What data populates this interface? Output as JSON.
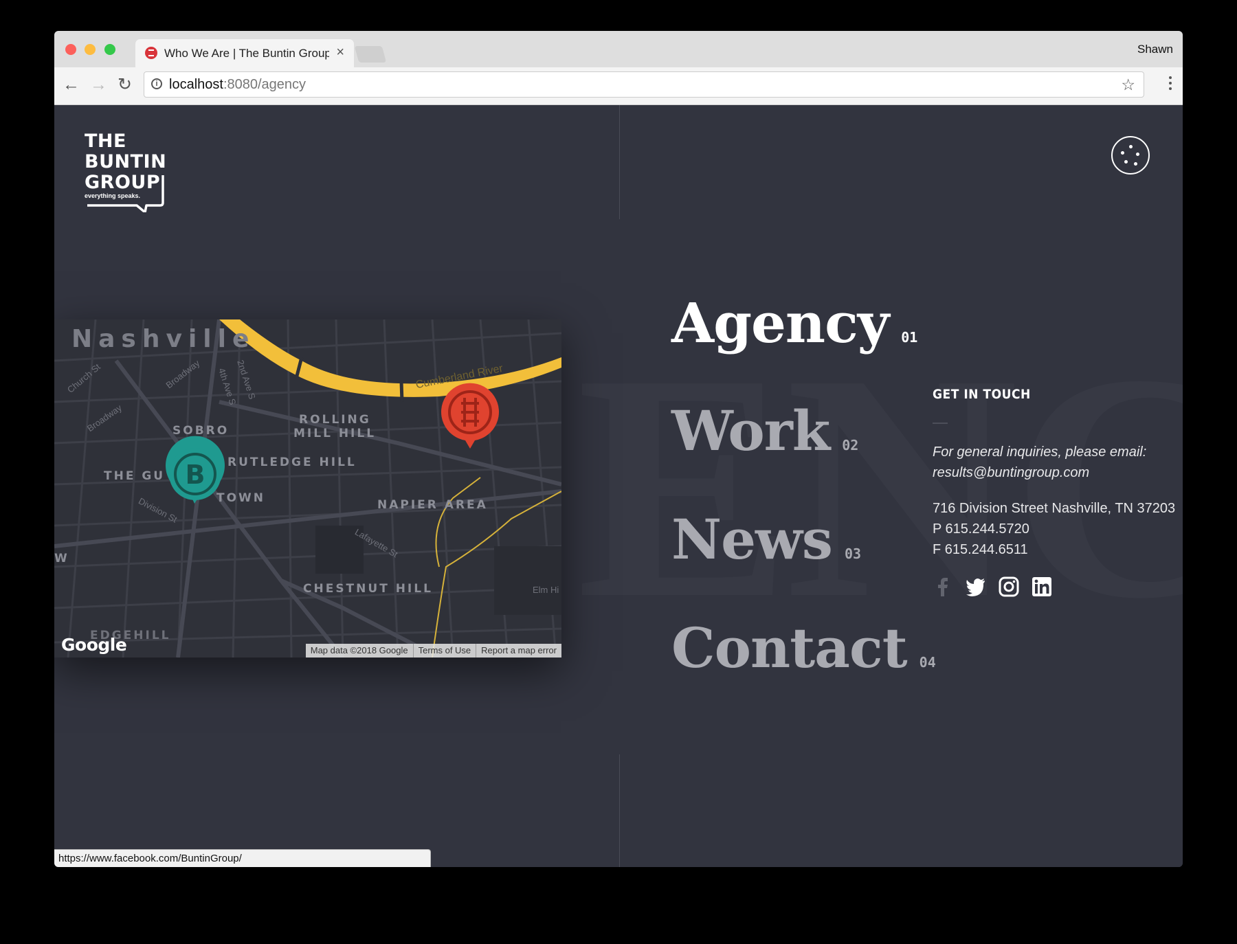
{
  "browser": {
    "tab_title": "Who We Are | The Buntin Group",
    "tab_close": "×",
    "profile_name": "Shawn",
    "url_host": "localhost",
    "url_path": ":8080/agency",
    "status_url": "https://www.facebook.com/BuntinGroup/"
  },
  "logo": {
    "line1": "THE",
    "line2": "BUNTIN",
    "line3": "GROUP",
    "tagline": "everything speaks."
  },
  "background_word": "ENCY",
  "map": {
    "city": "Nashville",
    "neighborhoods": [
      "SOBRO",
      "ROLLING",
      "MILL HILL",
      "RUTLEDGE HILL",
      "THE GU",
      "TOWN",
      "NAPIER AREA",
      "CHESTNUT HILL",
      "EDGEHILL",
      "W"
    ],
    "streets": [
      "Church St",
      "Broadway",
      "4th Ave S",
      "2nd Ave S",
      "Broadway",
      "Division St",
      "Lafayette St",
      "Elm Hi"
    ],
    "river": "Cumberland River",
    "google": "Google",
    "footer": [
      "Map data ©2018 Google",
      "Terms of Use",
      "Report a map error"
    ],
    "colors": {
      "river": "#f2bf3a",
      "marker_teal": "#1f9a90",
      "marker_red": "#e0432f"
    }
  },
  "nav": [
    {
      "label": "Agency",
      "num": "01"
    },
    {
      "label": "Work",
      "num": "02"
    },
    {
      "label": "News",
      "num": "03"
    },
    {
      "label": "Contact",
      "num": "04"
    }
  ],
  "contact": {
    "title": "GET IN TOUCH",
    "inquiry_line1": "For general inquiries, please email:",
    "inquiry_line2": "results@buntingroup.com",
    "address": "716 Division Street Nashville, TN 37203",
    "phone": "P 615.244.5720",
    "fax": "F 615.244.6511",
    "social_icons": [
      "facebook-icon",
      "twitter-icon",
      "instagram-icon",
      "linkedin-icon"
    ]
  }
}
